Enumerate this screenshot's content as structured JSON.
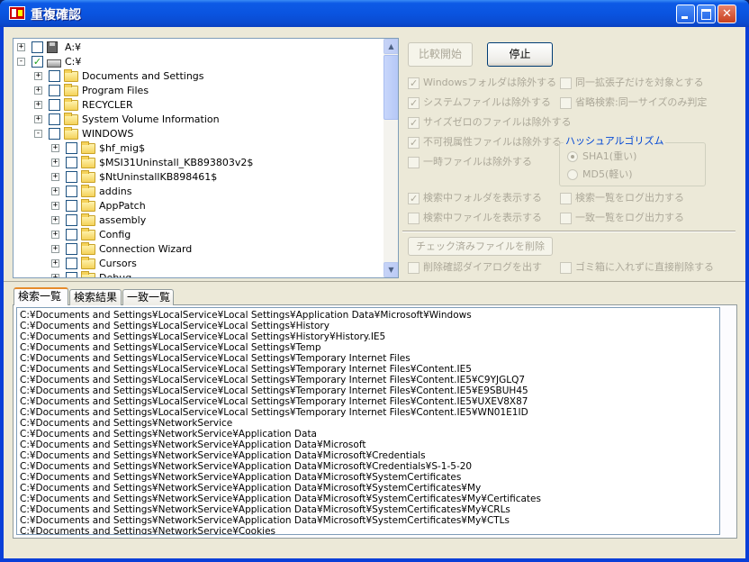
{
  "window": {
    "title": "重複確認"
  },
  "tree": {
    "nodes": [
      {
        "label": "A:¥",
        "depth": 0,
        "expander": "+",
        "checked": false,
        "icon": "floppy"
      },
      {
        "label": "C:¥",
        "depth": 0,
        "expander": "-",
        "checked": true,
        "icon": "drive"
      },
      {
        "label": "Documents and Settings",
        "depth": 1,
        "expander": "+",
        "checked": false,
        "icon": "folder"
      },
      {
        "label": "Program Files",
        "depth": 1,
        "expander": "+",
        "checked": false,
        "icon": "folder"
      },
      {
        "label": "RECYCLER",
        "depth": 1,
        "expander": "+",
        "checked": false,
        "icon": "folder"
      },
      {
        "label": "System Volume Information",
        "depth": 1,
        "expander": "+",
        "checked": false,
        "icon": "folder"
      },
      {
        "label": "WINDOWS",
        "depth": 1,
        "expander": "-",
        "checked": false,
        "icon": "folder"
      },
      {
        "label": "$hf_mig$",
        "depth": 2,
        "expander": "+",
        "checked": false,
        "icon": "folder"
      },
      {
        "label": "$MSI31Uninstall_KB893803v2$",
        "depth": 2,
        "expander": "+",
        "checked": false,
        "icon": "folder"
      },
      {
        "label": "$NtUninstallKB898461$",
        "depth": 2,
        "expander": "+",
        "checked": false,
        "icon": "folder"
      },
      {
        "label": "addins",
        "depth": 2,
        "expander": "+",
        "checked": false,
        "icon": "folder"
      },
      {
        "label": "AppPatch",
        "depth": 2,
        "expander": "+",
        "checked": false,
        "icon": "folder"
      },
      {
        "label": "assembly",
        "depth": 2,
        "expander": "+",
        "checked": false,
        "icon": "folder"
      },
      {
        "label": "Config",
        "depth": 2,
        "expander": "+",
        "checked": false,
        "icon": "folder"
      },
      {
        "label": "Connection Wizard",
        "depth": 2,
        "expander": "+",
        "checked": false,
        "icon": "folder"
      },
      {
        "label": "Cursors",
        "depth": 2,
        "expander": "+",
        "checked": false,
        "icon": "folder"
      },
      {
        "label": "Debug",
        "depth": 2,
        "expander": "+",
        "checked": false,
        "icon": "folder"
      }
    ]
  },
  "buttons": {
    "compare_start": "比較開始",
    "stop": "停止",
    "delete_checked": "チェック済みファイルを削除"
  },
  "options": {
    "exclude_windows": {
      "label": "Windowsフォルダは除外する",
      "checked": true
    },
    "same_ext_only": {
      "label": "同一拡張子だけを対象とする",
      "checked": false
    },
    "exclude_system": {
      "label": "システムファイルは除外する",
      "checked": true
    },
    "quick_search": {
      "label": "省略検索:同一サイズのみ判定",
      "checked": false
    },
    "exclude_zero": {
      "label": "サイズゼロのファイルは除外する",
      "checked": true
    },
    "exclude_hidden": {
      "label": "不可視属性ファイルは除外する",
      "checked": true
    },
    "exclude_temp": {
      "label": "一時ファイルは除外する",
      "checked": false
    },
    "show_folder": {
      "label": "検索中フォルダを表示する",
      "checked": true
    },
    "log_search": {
      "label": "検索一覧をログ出力する",
      "checked": false
    },
    "show_file": {
      "label": "検索中ファイルを表示する",
      "checked": false
    },
    "log_match": {
      "label": "一致一覧をログ出力する",
      "checked": false
    },
    "confirm_delete": {
      "label": "削除確認ダイアログを出す",
      "checked": false
    },
    "direct_delete": {
      "label": "ゴミ箱に入れずに直接削除する",
      "checked": false
    }
  },
  "hash": {
    "title": "ハッシュアルゴリズム",
    "sha1": {
      "label": "SHA1(重い)",
      "selected": true
    },
    "md5": {
      "label": "MD5(軽い)",
      "selected": false
    }
  },
  "tabs": [
    "検索一覧",
    "検索結果",
    "一致一覧"
  ],
  "log_lines": [
    "C:¥Documents and Settings¥LocalService¥Local Settings¥Application Data¥Microsoft¥Windows",
    "C:¥Documents and Settings¥LocalService¥Local Settings¥History",
    "C:¥Documents and Settings¥LocalService¥Local Settings¥History¥History.IE5",
    "C:¥Documents and Settings¥LocalService¥Local Settings¥Temp",
    "C:¥Documents and Settings¥LocalService¥Local Settings¥Temporary Internet Files",
    "C:¥Documents and Settings¥LocalService¥Local Settings¥Temporary Internet Files¥Content.IE5",
    "C:¥Documents and Settings¥LocalService¥Local Settings¥Temporary Internet Files¥Content.IE5¥C9YJGLQ7",
    "C:¥Documents and Settings¥LocalService¥Local Settings¥Temporary Internet Files¥Content.IE5¥E9SBUH45",
    "C:¥Documents and Settings¥LocalService¥Local Settings¥Temporary Internet Files¥Content.IE5¥UXEV8X87",
    "C:¥Documents and Settings¥LocalService¥Local Settings¥Temporary Internet Files¥Content.IE5¥WN01E1ID",
    "C:¥Documents and Settings¥NetworkService",
    "C:¥Documents and Settings¥NetworkService¥Application Data",
    "C:¥Documents and Settings¥NetworkService¥Application Data¥Microsoft",
    "C:¥Documents and Settings¥NetworkService¥Application Data¥Microsoft¥Credentials",
    "C:¥Documents and Settings¥NetworkService¥Application Data¥Microsoft¥Credentials¥S-1-5-20",
    "C:¥Documents and Settings¥NetworkService¥Application Data¥Microsoft¥SystemCertificates",
    "C:¥Documents and Settings¥NetworkService¥Application Data¥Microsoft¥SystemCertificates¥My",
    "C:¥Documents and Settings¥NetworkService¥Application Data¥Microsoft¥SystemCertificates¥My¥Certificates",
    "C:¥Documents and Settings¥NetworkService¥Application Data¥Microsoft¥SystemCertificates¥My¥CRLs",
    "C:¥Documents and Settings¥NetworkService¥Application Data¥Microsoft¥SystemCertificates¥My¥CTLs",
    "C:¥Documents and Settings¥NetworkService¥Cookies"
  ]
}
